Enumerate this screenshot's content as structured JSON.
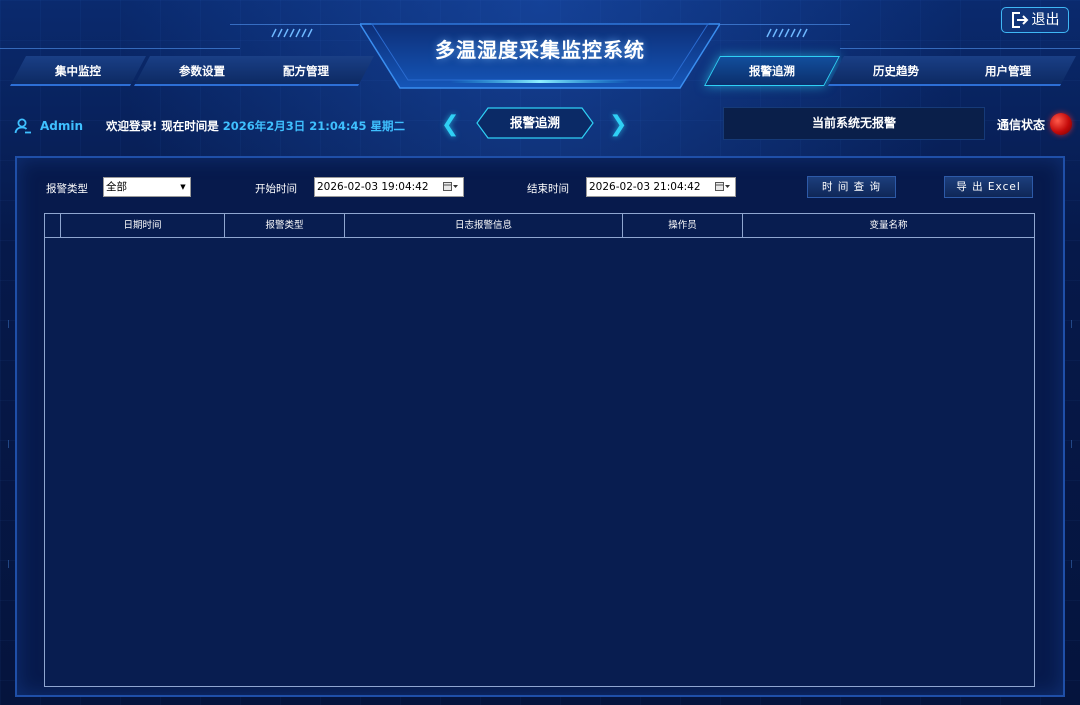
{
  "header": {
    "title": "多温湿度采集监控系统",
    "exit_label": "退出",
    "nav_tabs": [
      {
        "label": "集中监控",
        "active": false
      },
      {
        "label": "参数设置",
        "active": false
      },
      {
        "label": "配方管理",
        "active": false
      },
      {
        "label": "报警追溯",
        "active": true
      },
      {
        "label": "历史趋势",
        "active": false
      },
      {
        "label": "用户管理",
        "active": false
      }
    ]
  },
  "info_bar": {
    "user": "Admin",
    "welcome": "欢迎登录! 现在时间是",
    "datetime": "2026年2月3日 21:04:45 星期二",
    "page_title": "报警追溯",
    "nav_prev": "❮",
    "nav_next": "❯",
    "alarm_status": "当前系统无报警",
    "comm_label": "通信状态",
    "comm_status_color": "#d01010"
  },
  "filters": {
    "alarm_type_label": "报警类型",
    "alarm_type_value": "全部",
    "start_label": "开始时间",
    "start_value": "2026-02-03 19:04:42",
    "end_label": "结束时间",
    "end_value": "2026-02-03 21:04:42",
    "query_button": "时 间 查 询",
    "export_button": "导 出 Excel"
  },
  "table": {
    "columns": [
      "日期时间",
      "报警类型",
      "日志报警信息",
      "操作员",
      "变量名称"
    ],
    "rows": []
  },
  "colors": {
    "accent": "#2fd0f5",
    "background": "#06163f",
    "highlight_text": "#3fc0ff"
  }
}
